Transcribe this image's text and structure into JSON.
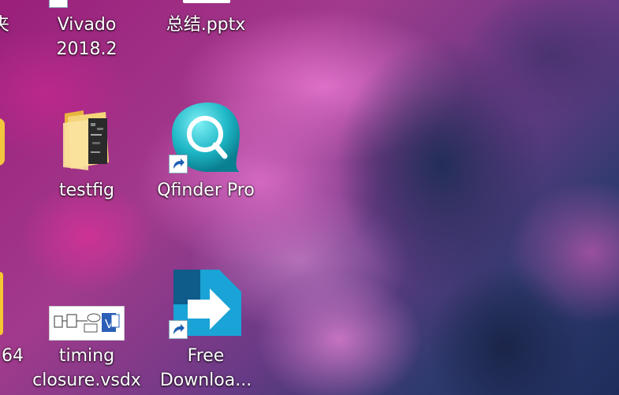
{
  "desktop": {
    "items": [
      {
        "label": "夹"
      },
      {
        "label_line1": "Vivado",
        "label_line2": "2018.2"
      },
      {
        "label": "总结.pptx"
      },
      {
        "label": "testfig"
      },
      {
        "label": "Qfinder Pro"
      },
      {
        "label": "64"
      },
      {
        "label_line1": "timing",
        "label_line2": "closure.vsdx"
      },
      {
        "label_line1": "Free",
        "label_line2": "Downloa..."
      }
    ]
  }
}
